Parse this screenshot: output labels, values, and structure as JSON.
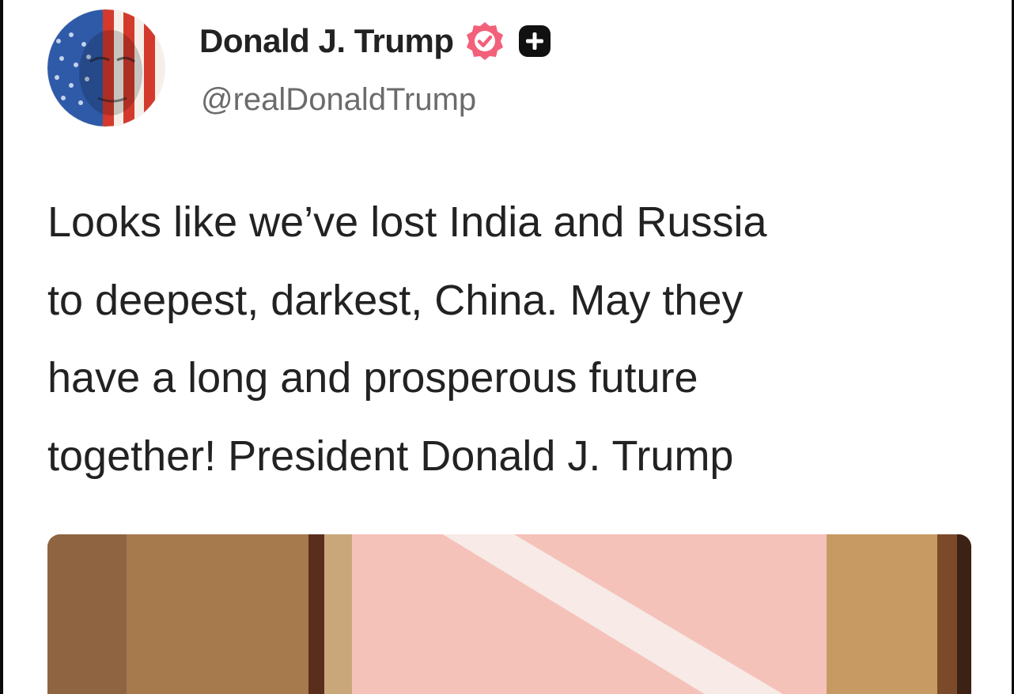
{
  "post": {
    "author": {
      "display_name": "Donald J. Trump",
      "handle": "@realDonaldTrump",
      "verified": true,
      "avatar": "american-flag-face-avatar"
    },
    "text_lines": [
      "Looks like we’ve lost India and Russia",
      "to deepest, darkest, China. May they",
      "have a long and prosperous future",
      "together! President Donald J. Trump"
    ],
    "media": {
      "kind": "photo"
    }
  },
  "icons": {
    "verified": "verified-badge-icon",
    "follow": "plus-icon"
  },
  "colors": {
    "verified_badge": "#f2607a",
    "text": "#222222",
    "handle": "#6b6b6b",
    "background": "#ffffff"
  }
}
